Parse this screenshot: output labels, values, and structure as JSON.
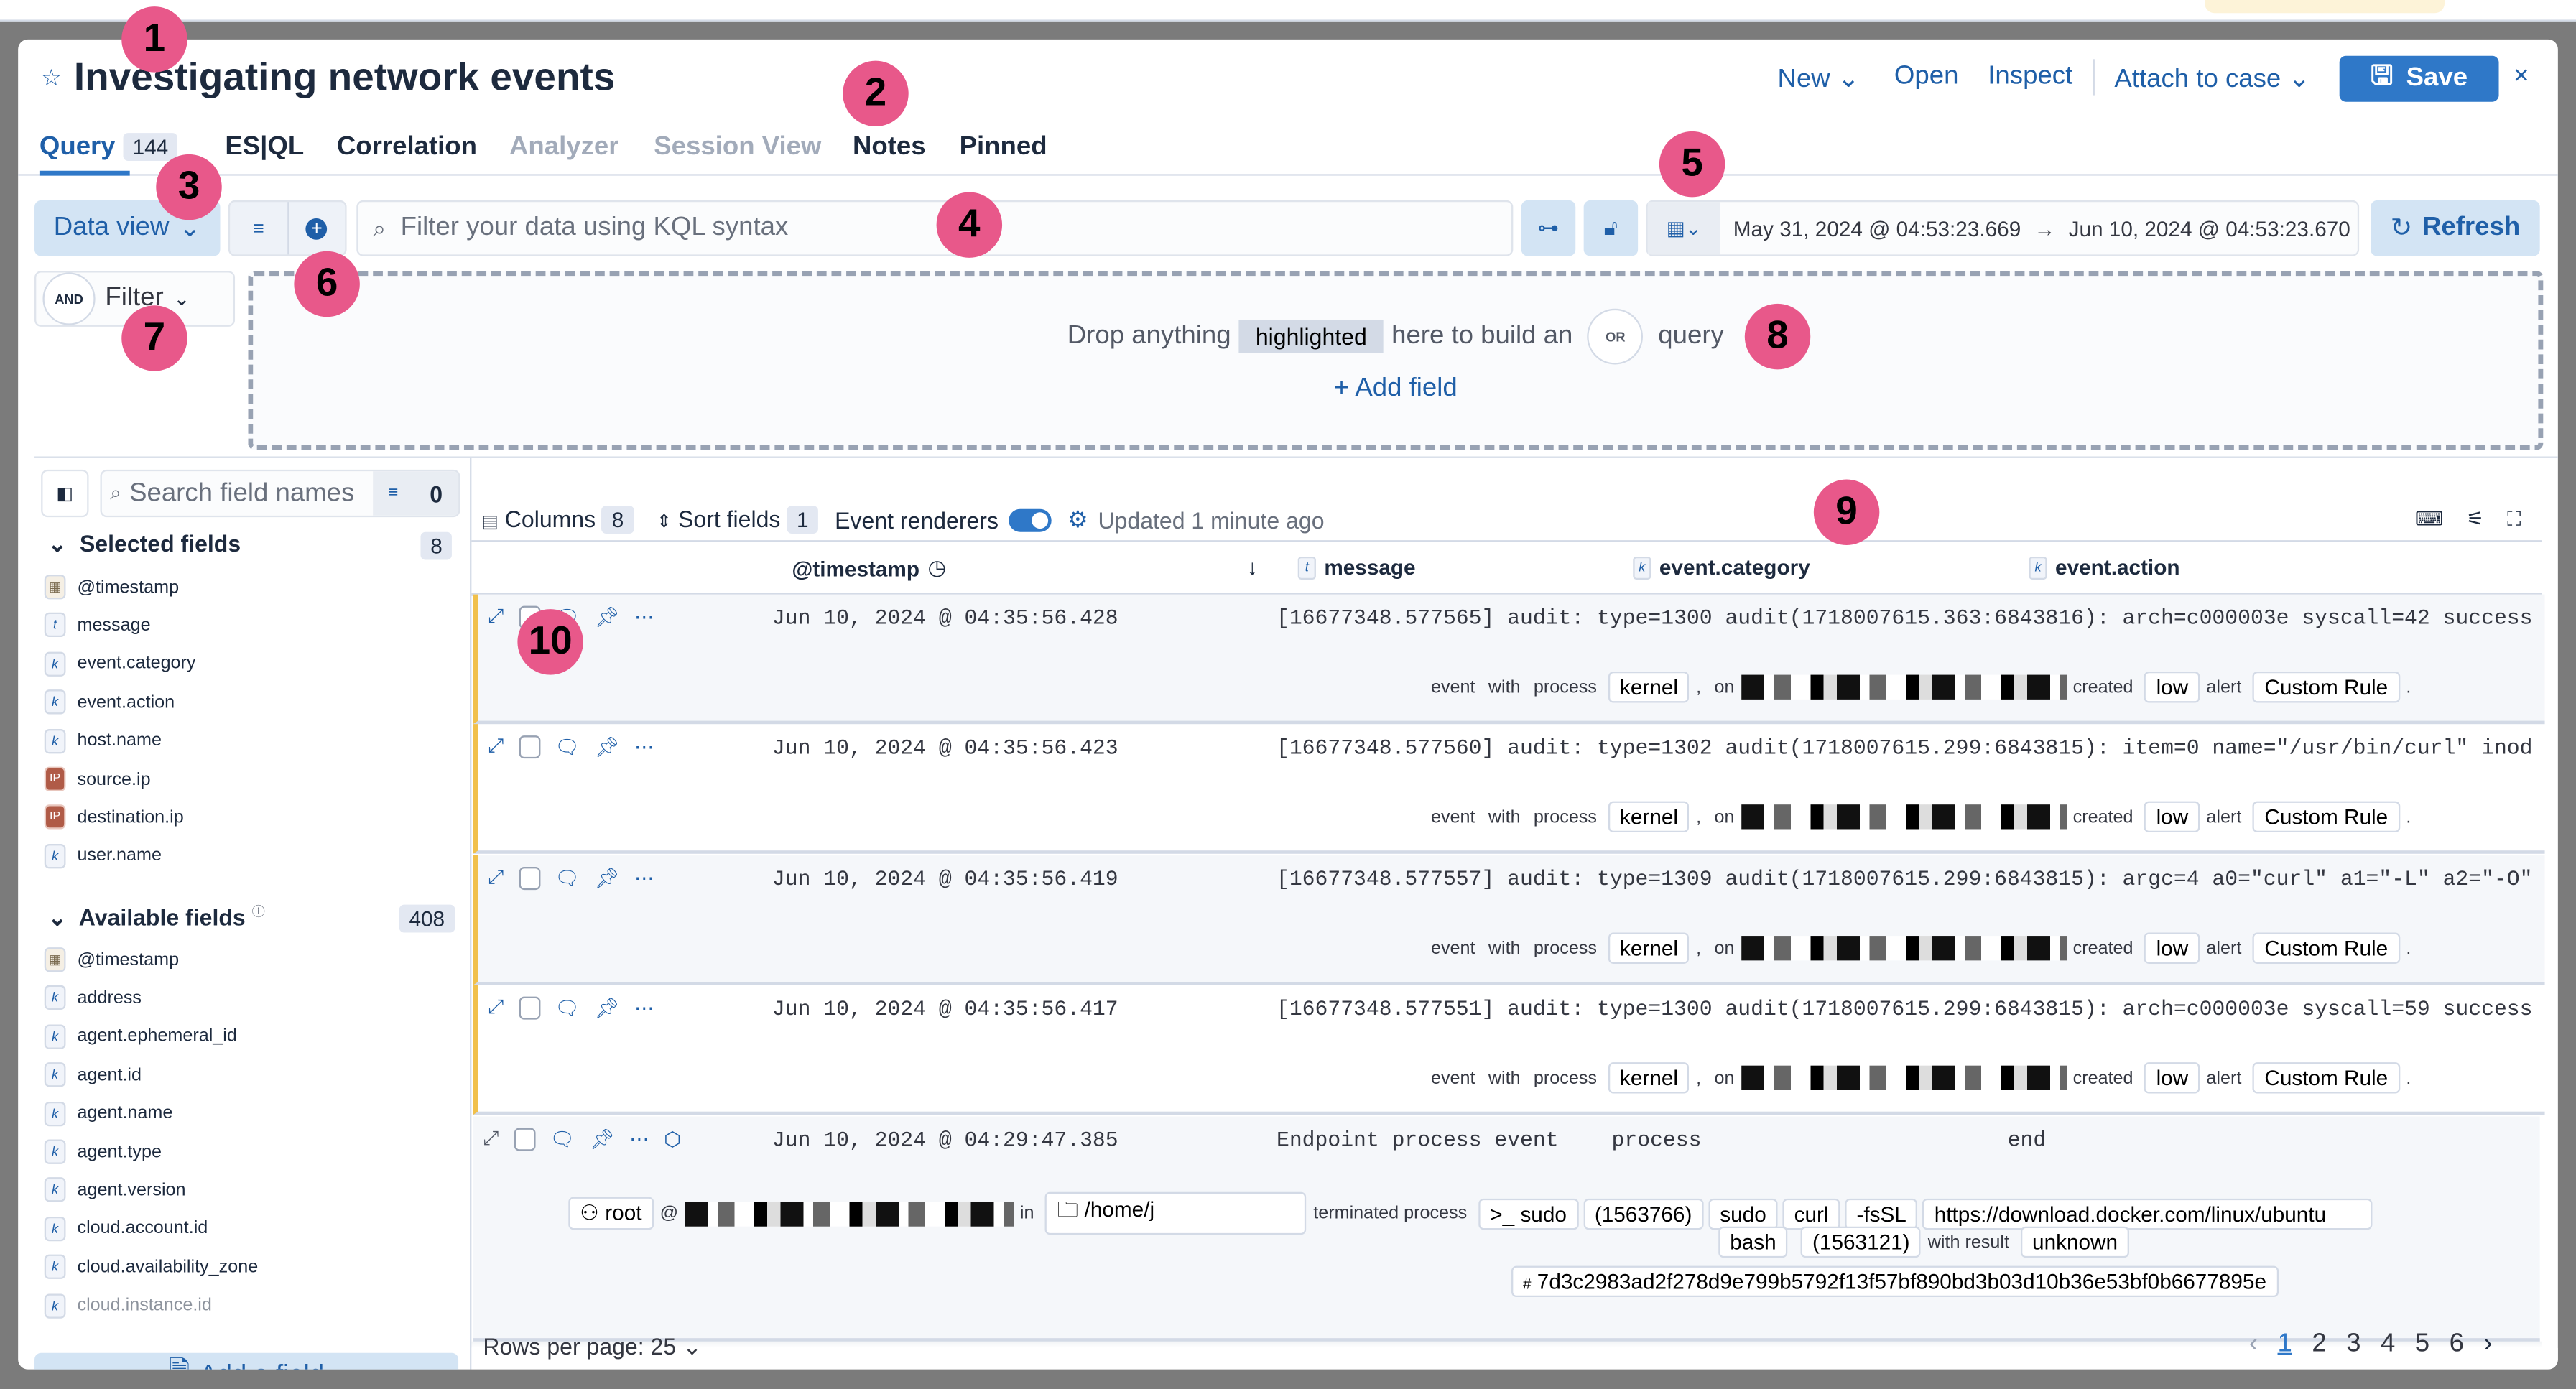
{
  "header": {
    "title": "Investigating network events",
    "actions": {
      "new": "New",
      "open": "Open",
      "inspect": "Inspect",
      "attach": "Attach to case",
      "save": "Save"
    }
  },
  "tabs": [
    {
      "label": "Query",
      "badge": "144",
      "active": true
    },
    {
      "label": "ES|QL"
    },
    {
      "label": "Correlation"
    },
    {
      "label": "Analyzer",
      "disabled": true
    },
    {
      "label": "Session View",
      "disabled": true
    },
    {
      "label": "Notes"
    },
    {
      "label": "Pinned"
    }
  ],
  "query_bar": {
    "data_view": "Data view",
    "kql_placeholder": "Filter your data using KQL syntax",
    "date_start": "May 31, 2024 @ 04:53:23.669",
    "date_end": "Jun 10, 2024 @ 04:53:23.670",
    "refresh": "Refresh"
  },
  "filter": {
    "and": "AND",
    "label": "Filter"
  },
  "dropzone": {
    "pre": "Drop anything",
    "highlight": "highlighted",
    "mid": "here to build an",
    "or": "OR",
    "post": "query",
    "add_field": "+ Add field"
  },
  "sidebar": {
    "search_placeholder": "Search field names",
    "filter_count": "0",
    "selected_title": "Selected fields",
    "selected_count": "8",
    "selected": [
      {
        "type": "date",
        "name": "@timestamp"
      },
      {
        "type": "t",
        "name": "message"
      },
      {
        "type": "k",
        "name": "event.category"
      },
      {
        "type": "k",
        "name": "event.action"
      },
      {
        "type": "k",
        "name": "host.name"
      },
      {
        "type": "IP",
        "name": "source.ip"
      },
      {
        "type": "IP",
        "name": "destination.ip"
      },
      {
        "type": "k",
        "name": "user.name"
      }
    ],
    "available_title": "Available fields",
    "available_count": "408",
    "available": [
      {
        "type": "date",
        "name": "@timestamp"
      },
      {
        "type": "k",
        "name": "address"
      },
      {
        "type": "k",
        "name": "agent.ephemeral_id"
      },
      {
        "type": "k",
        "name": "agent.id"
      },
      {
        "type": "k",
        "name": "agent.name"
      },
      {
        "type": "k",
        "name": "agent.type"
      },
      {
        "type": "k",
        "name": "agent.version"
      },
      {
        "type": "k",
        "name": "cloud.account.id"
      },
      {
        "type": "k",
        "name": "cloud.availability_zone"
      },
      {
        "type": "k",
        "name": "cloud.instance.id"
      }
    ],
    "add_field": "Add a field"
  },
  "table_toolbar": {
    "columns": "Columns",
    "columns_count": "8",
    "sort": "Sort fields",
    "sort_count": "1",
    "renderers": "Event renderers",
    "renderers_on": true,
    "updated": "Updated 1 minute ago"
  },
  "columns": [
    {
      "type": "",
      "label": "@timestamp"
    },
    {
      "type": "t",
      "label": "message"
    },
    {
      "type": "k",
      "label": "event.category"
    },
    {
      "type": "k",
      "label": "event.action"
    }
  ],
  "rows": [
    {
      "timestamp": "Jun 10, 2024 @ 04:35:56.428",
      "message": "[16677348.577565] audit: type=1300 audit(1718007615.363:6843816): arch=c000003e syscall=42 success",
      "process": "kernel",
      "severity": "low",
      "rule": "Custom Rule"
    },
    {
      "timestamp": "Jun 10, 2024 @ 04:35:56.423",
      "message": "[16677348.577560] audit: type=1302 audit(1718007615.299:6843815): item=0 name=\"/usr/bin/curl\" inod",
      "process": "kernel",
      "severity": "low",
      "rule": "Custom Rule"
    },
    {
      "timestamp": "Jun 10, 2024 @ 04:35:56.419",
      "message": "[16677348.577557] audit: type=1309 audit(1718007615.299:6843815): argc=4 a0=\"curl\" a1=\"-L\" a2=\"-O\"",
      "process": "kernel",
      "severity": "low",
      "rule": "Custom Rule"
    },
    {
      "timestamp": "Jun 10, 2024 @ 04:35:56.417",
      "message": "[16677348.577551] audit: type=1300 audit(1718007615.299:6843815): arch=c000003e syscall=59 success",
      "process": "kernel",
      "severity": "low",
      "rule": "Custom Rule"
    }
  ],
  "renderer_words": {
    "event": "event",
    "with": "with",
    "process": "process",
    "on": "on",
    "created": "created",
    "alert": "alert"
  },
  "endpoint_row": {
    "timestamp": "Jun 10, 2024 @ 04:29:47.385",
    "message": "Endpoint process event",
    "category": "process",
    "action": "end",
    "user": "root",
    "at": "@",
    "in": "in",
    "dir": "/home/j",
    "terminated": "terminated process",
    "proc": "sudo",
    "pid": "(1563766)",
    "args": [
      "sudo",
      "curl",
      "-fsSL",
      "https://download.docker.com/linux/ubuntu"
    ],
    "parent": "bash",
    "ppid": "(1563121)",
    "with_result": "with result",
    "result": "unknown",
    "hash": "7d3c2983ad2f278d9e799b5792f13f57bf890bd3b03d10b36e53bf0b6677895e"
  },
  "footer": {
    "rows_per_page": "Rows per page: 25",
    "pages": [
      "1",
      "2",
      "3",
      "4",
      "5",
      "6"
    ],
    "current_page": "1"
  },
  "markers": [
    "1",
    "2",
    "3",
    "4",
    "5",
    "6",
    "7",
    "8",
    "9",
    "10"
  ],
  "colors": {
    "accent": "#2f78c8",
    "link": "#1f5fa8",
    "marker": "#e8588a",
    "flag": "#f1c04b"
  }
}
